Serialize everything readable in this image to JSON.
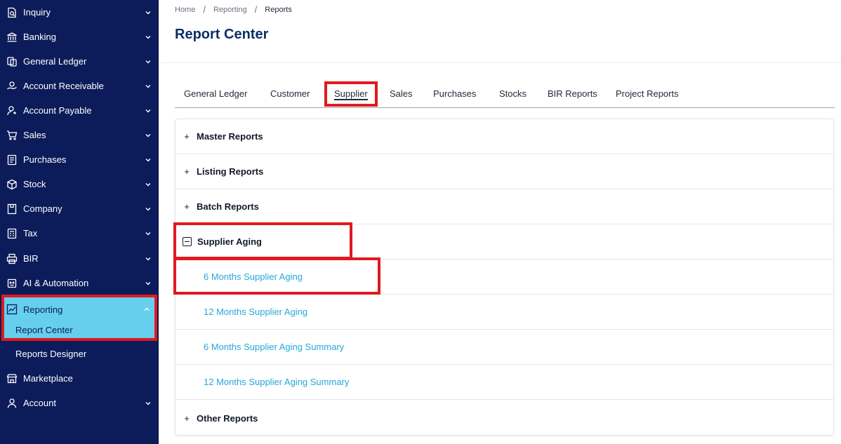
{
  "sidebar": {
    "items": [
      {
        "label": "Inquiry"
      },
      {
        "label": "Banking"
      },
      {
        "label": "General Ledger"
      },
      {
        "label": "Account Receivable"
      },
      {
        "label": "Account Payable"
      },
      {
        "label": "Sales"
      },
      {
        "label": "Purchases"
      },
      {
        "label": "Stock"
      },
      {
        "label": "Company"
      },
      {
        "label": "Tax"
      },
      {
        "label": "BIR"
      },
      {
        "label": "AI & Automation"
      },
      {
        "label": "Reporting"
      },
      {
        "label": "Report Center"
      },
      {
        "label": "Reports Designer"
      },
      {
        "label": "Marketplace"
      },
      {
        "label": "Account"
      }
    ]
  },
  "breadcrumb": [
    "Home",
    "Reporting",
    "Reports"
  ],
  "page": {
    "title": "Report Center"
  },
  "tabs": [
    "General Ledger",
    "Customer",
    "Supplier",
    "Sales",
    "Purchases",
    "Stocks",
    "BIR Reports",
    "Project Reports"
  ],
  "active_tab": "Supplier",
  "sections": {
    "master": "Master Reports",
    "listing": "Listing Reports",
    "batch": "Batch Reports",
    "aging": "Supplier Aging",
    "other": "Other Reports"
  },
  "aging_reports": [
    "6 Months Supplier Aging",
    "12 Months Supplier Aging",
    "6 Months Supplier Aging Summary",
    "12 Months Supplier Aging Summary"
  ],
  "colors": {
    "sidebar_bg": "#0c1c5a",
    "active_bg": "#67cfee",
    "highlight": "#e0191e",
    "link": "#26a6dc",
    "title": "#0c2f66"
  }
}
